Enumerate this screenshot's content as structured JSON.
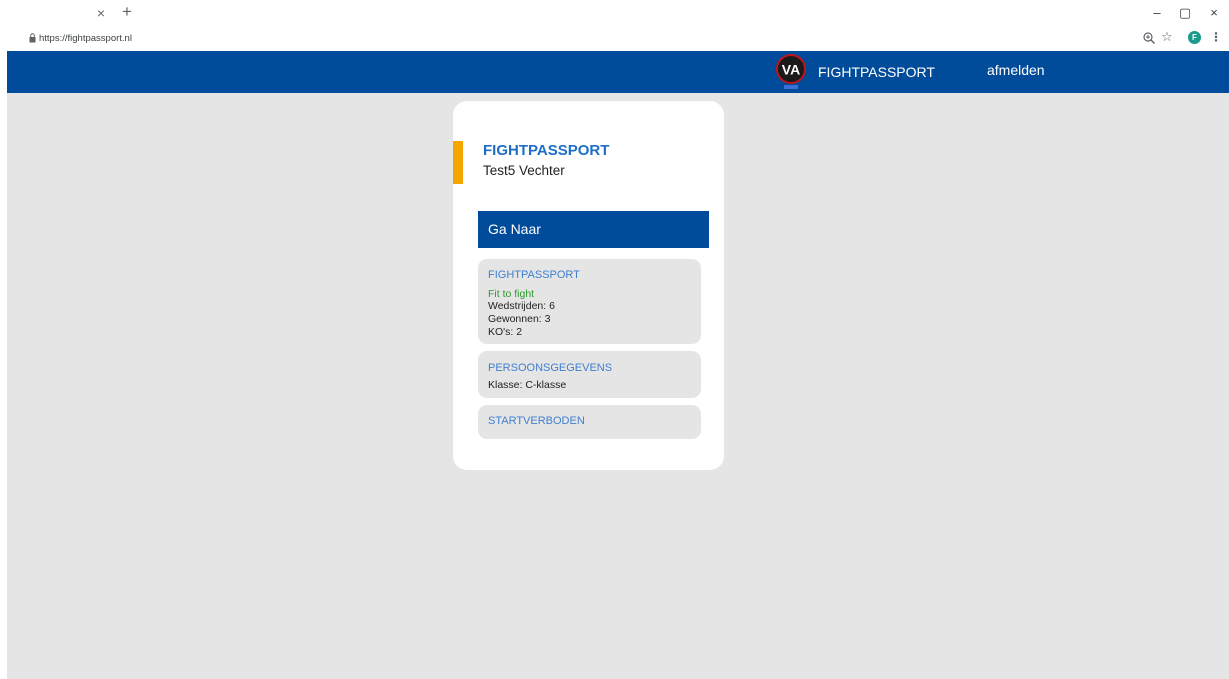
{
  "browser": {
    "tab_close": "×",
    "new_tab": "+",
    "window_controls": {
      "minimize": "–",
      "restore": "▢",
      "close": "×"
    },
    "url": "https://fightpassport.nl",
    "profile_initial": "F",
    "icons": [
      "lock-icon",
      "zoom-icon",
      "star-icon",
      "profile-icon",
      "menu-icon"
    ]
  },
  "header": {
    "brand_name": "FIGHTPASSPORT",
    "logo_initials": "VA",
    "logout_label": "afmelden",
    "background_color": "#004b9a"
  },
  "card": {
    "title": "FIGHTPASSPORT",
    "subtitle": "Test5 Vechter",
    "accent_color": "#f5a500",
    "goto_label": "Ga Naar"
  },
  "sections": [
    {
      "title": "FIGHTPASSPORT",
      "status": "Fit to fight",
      "lines": [
        "Wedstrijden: 6",
        "Gewonnen: 3",
        "KO's: 2"
      ]
    },
    {
      "title": "PERSOONSGEGEVENS",
      "lines": [
        "Klasse: C-klasse"
      ]
    },
    {
      "title": "STARTVERBODEN",
      "lines": []
    }
  ]
}
